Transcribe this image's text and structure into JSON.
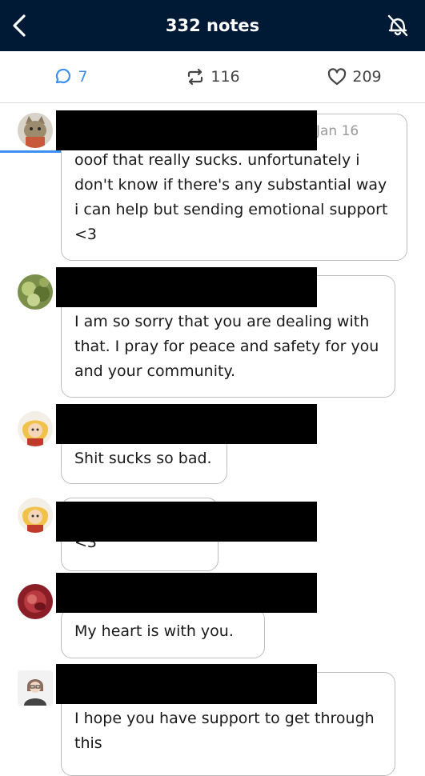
{
  "header": {
    "title": "332 notes",
    "bg_color": "#001935"
  },
  "tabs": {
    "replies_count": "7",
    "reblogs_count": "116",
    "likes_count": "209",
    "active_color": "#3d8ff2"
  },
  "replies": [
    {
      "date": "Jan 16",
      "text": "ooof that really sucks. unfortunately i don't know if there's any substantial way i can help but sending emotional support <3"
    },
    {
      "text": "I am so sorry that you are dealing with that. I pray for peace and safety for you and your community."
    },
    {
      "text": "Shit sucks so bad."
    },
    {
      "text": "<3"
    },
    {
      "text": "My heart is with you."
    },
    {
      "text": "I hope you have support to get through this"
    }
  ]
}
